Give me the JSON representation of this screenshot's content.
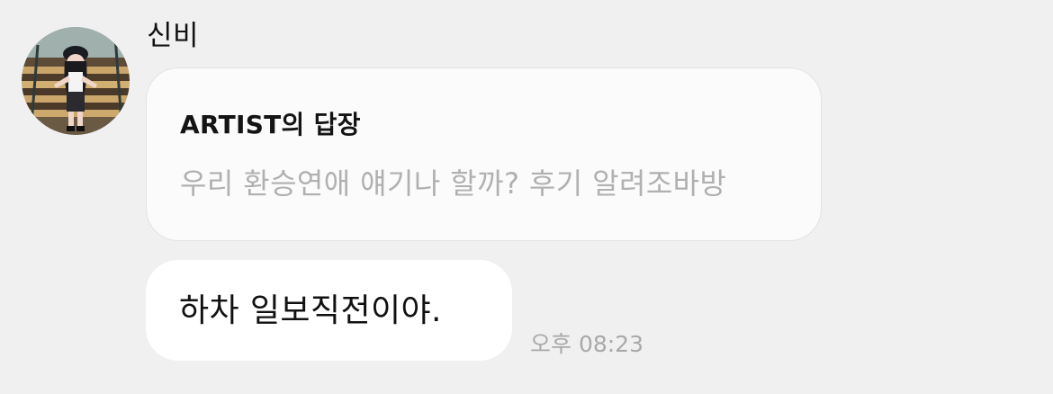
{
  "message": {
    "sender": "신비",
    "avatar_icon": "profile-photo",
    "reply": {
      "title": "ARTIST의 답장",
      "preview": "우리 환승연애 얘기나 할까? 후기 알려조바방"
    },
    "text": "하차 일보직전이야.",
    "time": "오후 08:23"
  },
  "colors": {
    "background": "#f0f0f0",
    "reply_bubble": "#fbfbfb",
    "message_bubble": "#ffffff",
    "muted_text": "#b0b0b0",
    "primary_text": "#111111"
  }
}
